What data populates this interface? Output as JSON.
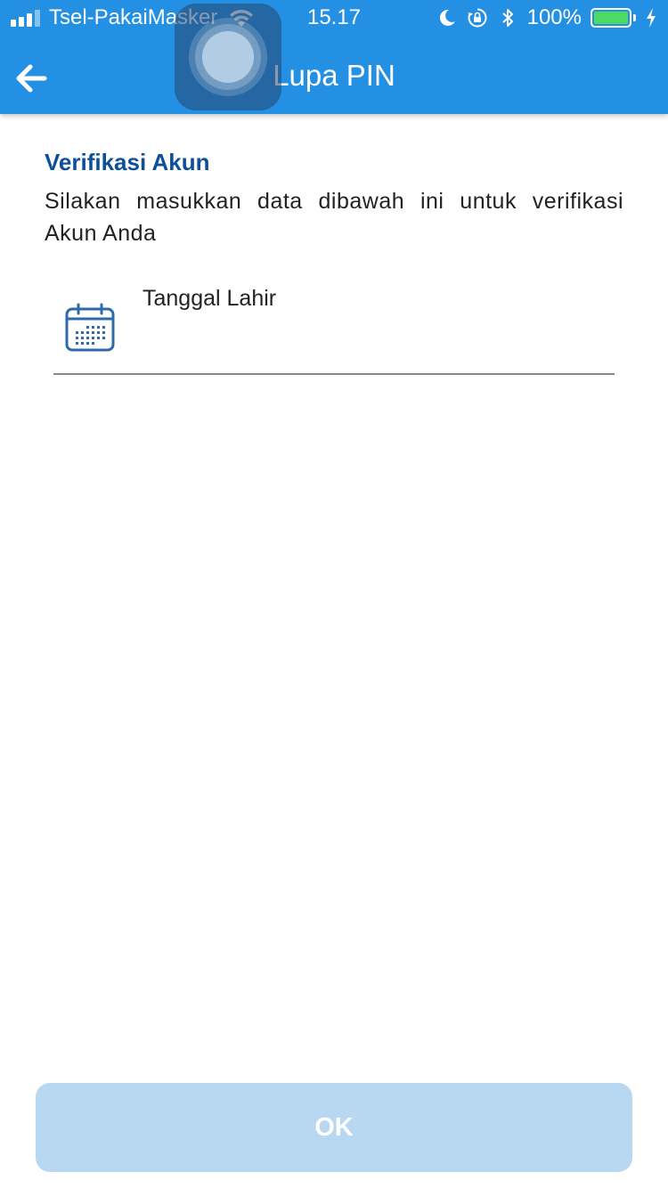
{
  "status_bar": {
    "carrier": "Tsel-PakaiMasker",
    "time": "15.17",
    "battery_percent": "100%",
    "battery_color": "#4cd964",
    "icons": [
      "signal-icon",
      "wifi-icon",
      "moon-icon",
      "rotation-lock-icon",
      "bluetooth-icon",
      "battery-icon",
      "charging-icon"
    ]
  },
  "header": {
    "title": "Lupa PIN",
    "background": "#2390e3",
    "back_icon": "arrow-left-icon"
  },
  "main": {
    "section_title": "Verifikasi Akun",
    "description": "Silakan masukkan data dibawah ini untuk verifikasi Akun Anda",
    "date_field": {
      "label": "Tanggal Lahir",
      "value": "",
      "icon": "calendar-icon"
    }
  },
  "footer": {
    "ok_label": "OK",
    "ok_state": "disabled"
  },
  "colors": {
    "accent": "#2390e3",
    "title_blue": "#0e4f9a",
    "button_disabled": "#b8d7f0"
  }
}
